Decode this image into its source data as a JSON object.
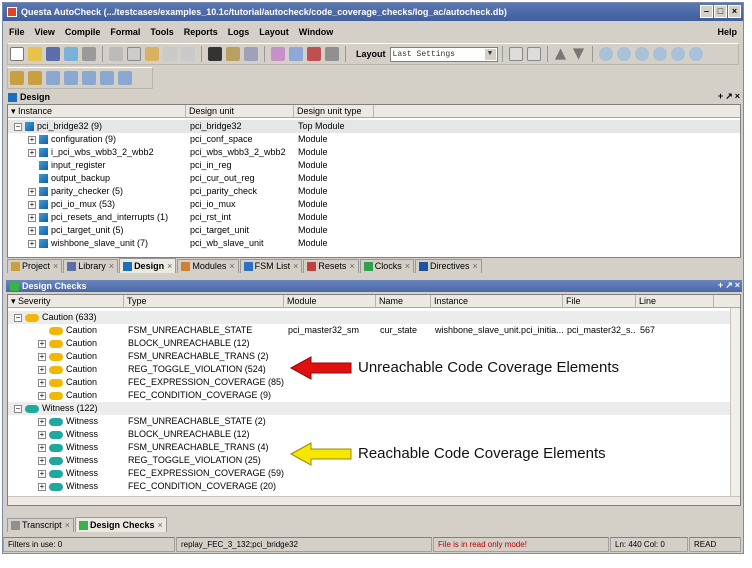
{
  "window": {
    "title": "Questa AutoCheck (.../testcases/examples_10.1c/tutorial/autocheck/code_coverage_checks/log_ac/autocheck.db)",
    "buttons": [
      "–",
      "□",
      "×"
    ]
  },
  "menu": {
    "items": [
      "File",
      "View",
      "Compile",
      "Formal",
      "Tools",
      "Reports",
      "Logs",
      "Layout",
      "Window"
    ],
    "help": "Help"
  },
  "toolbar": {
    "layout_label": "Layout",
    "layout_value": "Last Settings",
    "dropdown_arrow": "▼"
  },
  "design_panel": {
    "title": "Design",
    "controls": [
      "+",
      "↗",
      "×"
    ],
    "columns": [
      "Instance",
      "Design unit",
      "Design unit type"
    ],
    "rows": [
      {
        "expander": "−",
        "instance": "pci_bridge32 (9)",
        "unit": "pci_bridge32",
        "type": "Top Module"
      },
      {
        "expander": "+",
        "instance": "configuration (9)",
        "unit": "pci_conf_space",
        "type": "Module"
      },
      {
        "expander": "+",
        "instance": "i_pci_wbs_wbb3_2_wbb2",
        "unit": "pci_wbs_wbb3_2_wbb2",
        "type": "Module"
      },
      {
        "expander": "",
        "instance": "input_register",
        "unit": "pci_in_reg",
        "type": "Module"
      },
      {
        "expander": "",
        "instance": "output_backup",
        "unit": "pci_cur_out_reg",
        "type": "Module"
      },
      {
        "expander": "+",
        "instance": "parity_checker (5)",
        "unit": "pci_parity_check",
        "type": "Module"
      },
      {
        "expander": "+",
        "instance": "pci_io_mux (53)",
        "unit": "pci_io_mux",
        "type": "Module"
      },
      {
        "expander": "+",
        "instance": "pci_resets_and_interrupts (1)",
        "unit": "pci_rst_int",
        "type": "Module"
      },
      {
        "expander": "+",
        "instance": "pci_target_unit (5)",
        "unit": "pci_target_unit",
        "type": "Module"
      },
      {
        "expander": "+",
        "instance": "wishbone_slave_unit (7)",
        "unit": "pci_wb_slave_unit",
        "type": "Module"
      }
    ]
  },
  "top_tabs": [
    {
      "label": "Project",
      "active": false
    },
    {
      "label": "Library",
      "active": false
    },
    {
      "label": "Design",
      "active": true
    },
    {
      "label": "Modules",
      "active": false
    },
    {
      "label": "FSM List",
      "active": false
    },
    {
      "label": "Resets",
      "active": false
    },
    {
      "label": "Clocks",
      "active": false
    },
    {
      "label": "Directives",
      "active": false
    }
  ],
  "tab_close": "×",
  "checks_panel": {
    "title": "Design Checks",
    "controls": [
      "+",
      "↗",
      "×"
    ],
    "columns": [
      "Severity",
      "Type",
      "Module",
      "Name",
      "Instance",
      "File",
      "Line"
    ],
    "rows": [
      {
        "level": 0,
        "expander": "−",
        "severity": "Caution (633)",
        "kind": "caution",
        "type": "",
        "module": "",
        "name": "",
        "instance": "",
        "file": "",
        "line": ""
      },
      {
        "level": 1,
        "expander": "",
        "severity": "Caution",
        "kind": "caution",
        "type": "FSM_UNREACHABLE_STATE",
        "module": "pci_master32_sm",
        "name": "cur_state",
        "instance": "wishbone_slave_unit.pci_initia...",
        "file": "pci_master32_s...",
        "line": "567"
      },
      {
        "level": 1,
        "expander": "+",
        "severity": "Caution",
        "kind": "caution",
        "type": "BLOCK_UNREACHABLE (12)",
        "module": "",
        "name": "",
        "instance": "",
        "file": "",
        "line": ""
      },
      {
        "level": 1,
        "expander": "+",
        "severity": "Caution",
        "kind": "caution",
        "type": "FSM_UNREACHABLE_TRANS (2)",
        "module": "",
        "name": "",
        "instance": "",
        "file": "",
        "line": ""
      },
      {
        "level": 1,
        "expander": "+",
        "severity": "Caution",
        "kind": "caution",
        "type": "REG_TOGGLE_VIOLATION (524)",
        "module": "",
        "name": "",
        "instance": "",
        "file": "",
        "line": ""
      },
      {
        "level": 1,
        "expander": "+",
        "severity": "Caution",
        "kind": "caution",
        "type": "FEC_EXPRESSION_COVERAGE (85)",
        "module": "",
        "name": "",
        "instance": "",
        "file": "",
        "line": ""
      },
      {
        "level": 1,
        "expander": "+",
        "severity": "Caution",
        "kind": "caution",
        "type": "FEC_CONDITION_COVERAGE (9)",
        "module": "",
        "name": "",
        "instance": "",
        "file": "",
        "line": ""
      },
      {
        "level": 0,
        "expander": "−",
        "severity": "Witness (122)",
        "kind": "witness",
        "type": "",
        "module": "",
        "name": "",
        "instance": "",
        "file": "",
        "line": ""
      },
      {
        "level": 1,
        "expander": "+",
        "severity": "Witness",
        "kind": "witness",
        "type": "FSM_UNREACHABLE_STATE (2)",
        "module": "",
        "name": "",
        "instance": "",
        "file": "",
        "line": ""
      },
      {
        "level": 1,
        "expander": "+",
        "severity": "Witness",
        "kind": "witness",
        "type": "BLOCK_UNREACHABLE (12)",
        "module": "",
        "name": "",
        "instance": "",
        "file": "",
        "line": ""
      },
      {
        "level": 1,
        "expander": "+",
        "severity": "Witness",
        "kind": "witness",
        "type": "FSM_UNREACHABLE_TRANS (4)",
        "module": "",
        "name": "",
        "instance": "",
        "file": "",
        "line": ""
      },
      {
        "level": 1,
        "expander": "+",
        "severity": "Witness",
        "kind": "witness",
        "type": "REG_TOGGLE_VIOLATION (25)",
        "module": "",
        "name": "",
        "instance": "",
        "file": "",
        "line": ""
      },
      {
        "level": 1,
        "expander": "+",
        "severity": "Witness",
        "kind": "witness",
        "type": "FEC_EXPRESSION_COVERAGE (59)",
        "module": "",
        "name": "",
        "instance": "",
        "file": "",
        "line": ""
      },
      {
        "level": 1,
        "expander": "+",
        "severity": "Witness",
        "kind": "witness",
        "type": "FEC_CONDITION_COVERAGE (20)",
        "module": "",
        "name": "",
        "instance": "",
        "file": "",
        "line": ""
      }
    ]
  },
  "bottom_tabs": [
    {
      "label": "Transcript",
      "active": false
    },
    {
      "label": "Design Checks",
      "active": true
    }
  ],
  "annotations": {
    "unreachable": "Unreachable Code Coverage Elements",
    "reachable": "Reachable Code Coverage Elements"
  },
  "status": {
    "filters": "Filters in use: 0",
    "context": "replay_FEC_3_132;pci_bridge32",
    "message": "File is in read only mode!",
    "position": "Ln:  440  Col:  0",
    "mode": "READ"
  },
  "colors": {
    "title_bar": "#4a68a8",
    "caution": "#f2b705",
    "witness": "#1fa8a0",
    "red_arrow": "#e01010",
    "yellow_arrow": "#f7e600",
    "status_message": "#c00000"
  }
}
